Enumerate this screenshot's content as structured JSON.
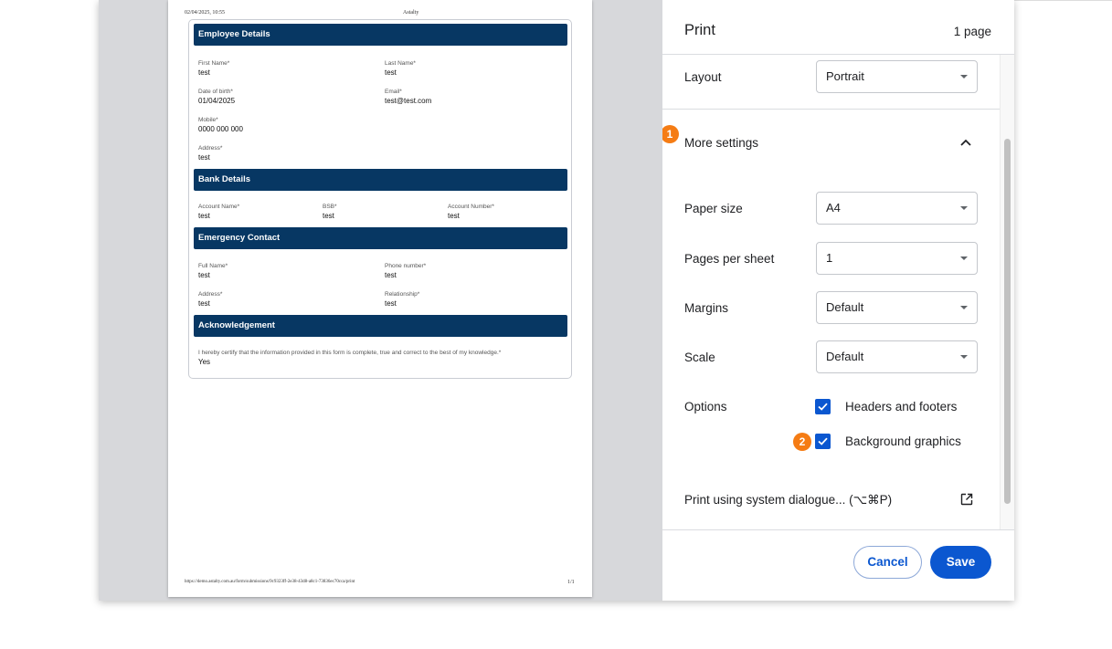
{
  "preview": {
    "header_date": "02/04/2025, 10:55",
    "header_title": "Astalty",
    "footer_url": "https://demo.astalty.com.au/form/submissions/9c9323ff-2e38-43d8-a8c1-73836ec70cca/print",
    "footer_page": "1/1",
    "sections": {
      "employee": {
        "title": "Employee Details",
        "first_name": {
          "label": "First Name*",
          "value": "test"
        },
        "last_name": {
          "label": "Last Name*",
          "value": "test"
        },
        "dob": {
          "label": "Date of birth*",
          "value": "01/04/2025"
        },
        "email": {
          "label": "Email*",
          "value": "test@test.com"
        },
        "mobile": {
          "label": "Mobile*",
          "value": "0000 000 000"
        },
        "address": {
          "label": "Address*",
          "value": "test"
        }
      },
      "bank": {
        "title": "Bank Details",
        "account_name": {
          "label": "Account Name*",
          "value": "test"
        },
        "bsb": {
          "label": "BSB*",
          "value": "test"
        },
        "account_number": {
          "label": "Account Number*",
          "value": "test"
        }
      },
      "emergency": {
        "title": "Emergency Contact",
        "full_name": {
          "label": "Full Name*",
          "value": "test"
        },
        "phone": {
          "label": "Phone number*",
          "value": "test"
        },
        "address": {
          "label": "Address*",
          "value": "test"
        },
        "relationship": {
          "label": "Relationship*",
          "value": "test"
        }
      },
      "ack": {
        "title": "Acknowledgement",
        "statement": {
          "label": "I hereby certify that the information provided in this form is complete, true and correct to the best of my knowledge.*",
          "value": "Yes"
        }
      }
    }
  },
  "print_panel": {
    "title": "Print",
    "page_count": "1 page",
    "layout": {
      "label": "Layout",
      "value": "Portrait"
    },
    "more_settings": {
      "label": "More settings",
      "expanded": true,
      "badge": "1"
    },
    "paper_size": {
      "label": "Paper size",
      "value": "A4"
    },
    "pages_per_sheet": {
      "label": "Pages per sheet",
      "value": "1"
    },
    "margins": {
      "label": "Margins",
      "value": "Default"
    },
    "scale": {
      "label": "Scale",
      "value": "Default"
    },
    "options": {
      "label": "Options",
      "headers_footers": {
        "label": "Headers and footers",
        "checked": true
      },
      "background_graphics": {
        "label": "Background graphics",
        "checked": true,
        "badge": "2"
      }
    },
    "system_dialog": {
      "label": "Print using system dialogue... (⌥⌘P)",
      "icon": "open-in-new-icon"
    },
    "cancel_label": "Cancel",
    "save_label": "Save"
  },
  "colors": {
    "accent": "#0b57d0",
    "section_header": "#073763",
    "badge": "#f57c14"
  }
}
